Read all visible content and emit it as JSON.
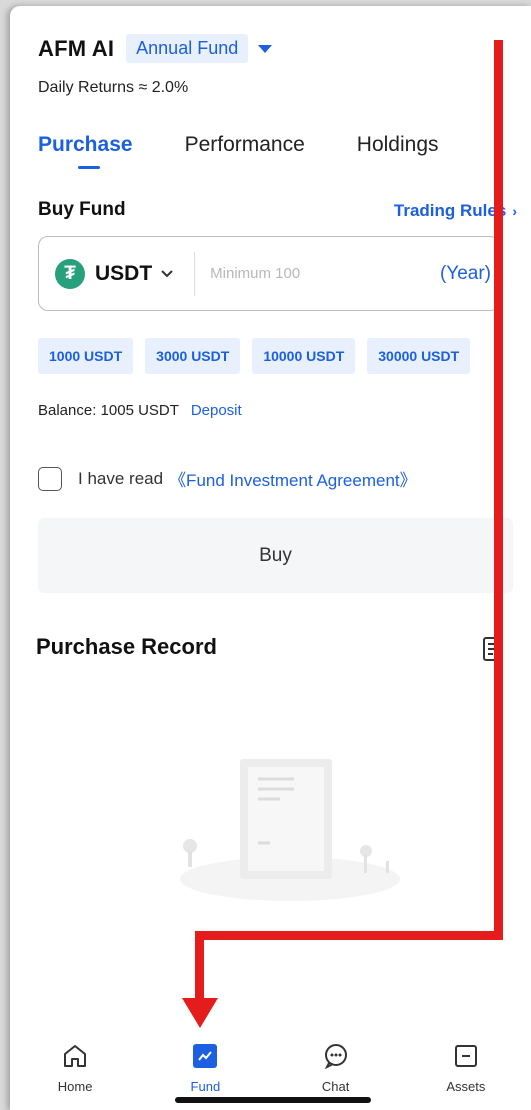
{
  "header": {
    "title": "AFM AI",
    "fund_selector": "Annual Fund",
    "daily_returns": "Daily Returns ≈ 2.0%"
  },
  "tabs": [
    {
      "label": "Purchase",
      "active": true
    },
    {
      "label": "Performance",
      "active": false
    },
    {
      "label": "Holdings",
      "active": false
    }
  ],
  "buy": {
    "title": "Buy Fund",
    "trading_rules": "Trading Rules",
    "currency": "USDT",
    "amount_placeholder": "Minimum 100",
    "period": "(Year)",
    "presets": [
      "1000 USDT",
      "3000 USDT",
      "10000 USDT",
      "30000 USDT"
    ],
    "balance": "Balance: 1005 USDT",
    "deposit": "Deposit",
    "agree_text": "I have read",
    "agreement_link": "《Fund Investment Agreement》",
    "buy_button": "Buy"
  },
  "record": {
    "title": "Purchase Record"
  },
  "tabbar": [
    {
      "label": "Home",
      "icon": "home-icon",
      "active": false
    },
    {
      "label": "Fund",
      "icon": "fund-chart-icon",
      "active": true
    },
    {
      "label": "Chat",
      "icon": "chat-icon",
      "active": false
    },
    {
      "label": "Assets",
      "icon": "assets-icon",
      "active": false
    }
  ],
  "colors": {
    "accent": "#1c5fe0",
    "annotation_arrow": "#e51c1c",
    "tether_green": "#26a17b"
  }
}
